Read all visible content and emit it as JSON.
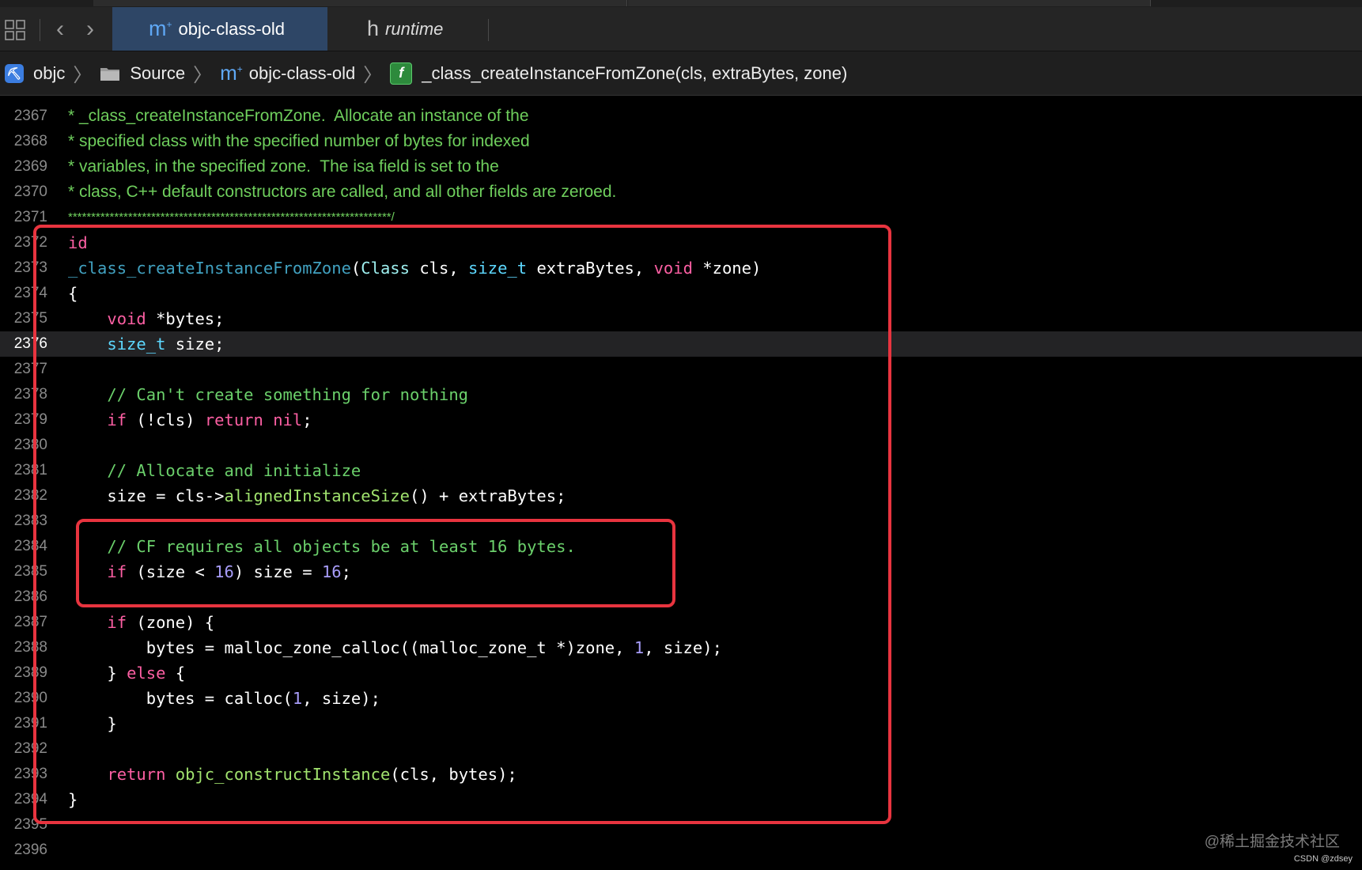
{
  "tabs": [
    {
      "label": "objc-class-old",
      "icon": "m-plus-file-icon",
      "active": true
    },
    {
      "label": "runtime",
      "icon": "h-file-icon",
      "active": false
    }
  ],
  "breadcrumb": [
    {
      "label": "objc",
      "icon": "app-project-icon"
    },
    {
      "label": "Source",
      "icon": "folder-icon"
    },
    {
      "label": "objc-class-old",
      "icon": "m-plus-file-icon"
    },
    {
      "label": "_class_createInstanceFromZone(cls, extraBytes, zone)",
      "icon": "function-icon"
    }
  ],
  "code": {
    "current_line": "2376",
    "lines": [
      {
        "n": "2367",
        "text": "* _class_createInstanceFromZone.  Allocate an instance of the"
      },
      {
        "n": "2368",
        "text": "* specified class with the specified number of bytes for indexed"
      },
      {
        "n": "2369",
        "text": "* variables, in the specified zone.  The isa field is set to the"
      },
      {
        "n": "2370",
        "text": "* class, C++ default constructors are called, and all other fields are zeroed."
      },
      {
        "n": "2371",
        "text": "**********************************************************************/"
      },
      {
        "n": "2372",
        "text": "id"
      },
      {
        "n": "2373",
        "text": "_class_createInstanceFromZone(Class cls, size_t extraBytes, void *zone)"
      },
      {
        "n": "2374",
        "text": "{"
      },
      {
        "n": "2375",
        "text": "    void *bytes;"
      },
      {
        "n": "2376",
        "text": "    size_t size;"
      },
      {
        "n": "2377",
        "text": ""
      },
      {
        "n": "2378",
        "text": "    // Can't create something for nothing"
      },
      {
        "n": "2379",
        "text": "    if (!cls) return nil;"
      },
      {
        "n": "2380",
        "text": ""
      },
      {
        "n": "2381",
        "text": "    // Allocate and initialize"
      },
      {
        "n": "2382",
        "text": "    size = cls->alignedInstanceSize() + extraBytes;"
      },
      {
        "n": "2383",
        "text": ""
      },
      {
        "n": "2384",
        "text": "    // CF requires all objects be at least 16 bytes."
      },
      {
        "n": "2385",
        "text": "    if (size < 16) size = 16;"
      },
      {
        "n": "2386",
        "text": ""
      },
      {
        "n": "2387",
        "text": "    if (zone) {"
      },
      {
        "n": "2388",
        "text": "        bytes = malloc_zone_calloc((malloc_zone_t *)zone, 1, size);"
      },
      {
        "n": "2389",
        "text": "    } else {"
      },
      {
        "n": "2390",
        "text": "        bytes = calloc(1, size);"
      },
      {
        "n": "2391",
        "text": "    }"
      },
      {
        "n": "2392",
        "text": ""
      },
      {
        "n": "2393",
        "text": "    return objc_constructInstance(cls, bytes);"
      },
      {
        "n": "2394",
        "text": "}"
      },
      {
        "n": "2395",
        "text": ""
      },
      {
        "n": "2396",
        "text": ""
      }
    ]
  },
  "colors": {
    "highlight_box": "#e8343f",
    "keyword": "#fc5fa3",
    "type": "#5dd8ff",
    "comment": "#6bd06b",
    "number": "#a79cf8"
  },
  "watermark": "@稀土掘金技术社区",
  "credit": "CSDN @zdsey"
}
